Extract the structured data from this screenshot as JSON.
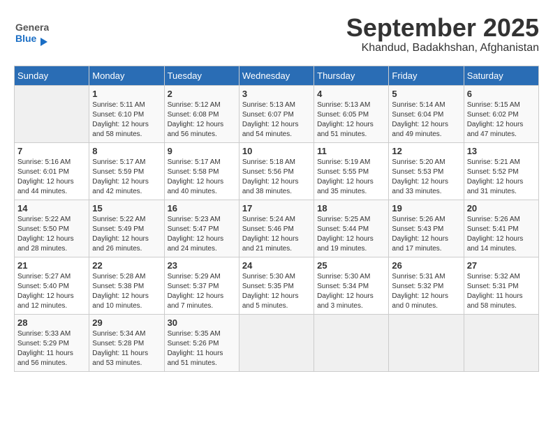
{
  "header": {
    "logo_general": "General",
    "logo_blue": "Blue",
    "month": "September 2025",
    "location": "Khandud, Badakhshan, Afghanistan"
  },
  "weekdays": [
    "Sunday",
    "Monday",
    "Tuesday",
    "Wednesday",
    "Thursday",
    "Friday",
    "Saturday"
  ],
  "weeks": [
    [
      {
        "day": "",
        "info": ""
      },
      {
        "day": "1",
        "info": "Sunrise: 5:11 AM\nSunset: 6:10 PM\nDaylight: 12 hours\nand 58 minutes."
      },
      {
        "day": "2",
        "info": "Sunrise: 5:12 AM\nSunset: 6:08 PM\nDaylight: 12 hours\nand 56 minutes."
      },
      {
        "day": "3",
        "info": "Sunrise: 5:13 AM\nSunset: 6:07 PM\nDaylight: 12 hours\nand 54 minutes."
      },
      {
        "day": "4",
        "info": "Sunrise: 5:13 AM\nSunset: 6:05 PM\nDaylight: 12 hours\nand 51 minutes."
      },
      {
        "day": "5",
        "info": "Sunrise: 5:14 AM\nSunset: 6:04 PM\nDaylight: 12 hours\nand 49 minutes."
      },
      {
        "day": "6",
        "info": "Sunrise: 5:15 AM\nSunset: 6:02 PM\nDaylight: 12 hours\nand 47 minutes."
      }
    ],
    [
      {
        "day": "7",
        "info": "Sunrise: 5:16 AM\nSunset: 6:01 PM\nDaylight: 12 hours\nand 44 minutes."
      },
      {
        "day": "8",
        "info": "Sunrise: 5:17 AM\nSunset: 5:59 PM\nDaylight: 12 hours\nand 42 minutes."
      },
      {
        "day": "9",
        "info": "Sunrise: 5:17 AM\nSunset: 5:58 PM\nDaylight: 12 hours\nand 40 minutes."
      },
      {
        "day": "10",
        "info": "Sunrise: 5:18 AM\nSunset: 5:56 PM\nDaylight: 12 hours\nand 38 minutes."
      },
      {
        "day": "11",
        "info": "Sunrise: 5:19 AM\nSunset: 5:55 PM\nDaylight: 12 hours\nand 35 minutes."
      },
      {
        "day": "12",
        "info": "Sunrise: 5:20 AM\nSunset: 5:53 PM\nDaylight: 12 hours\nand 33 minutes."
      },
      {
        "day": "13",
        "info": "Sunrise: 5:21 AM\nSunset: 5:52 PM\nDaylight: 12 hours\nand 31 minutes."
      }
    ],
    [
      {
        "day": "14",
        "info": "Sunrise: 5:22 AM\nSunset: 5:50 PM\nDaylight: 12 hours\nand 28 minutes."
      },
      {
        "day": "15",
        "info": "Sunrise: 5:22 AM\nSunset: 5:49 PM\nDaylight: 12 hours\nand 26 minutes."
      },
      {
        "day": "16",
        "info": "Sunrise: 5:23 AM\nSunset: 5:47 PM\nDaylight: 12 hours\nand 24 minutes."
      },
      {
        "day": "17",
        "info": "Sunrise: 5:24 AM\nSunset: 5:46 PM\nDaylight: 12 hours\nand 21 minutes."
      },
      {
        "day": "18",
        "info": "Sunrise: 5:25 AM\nSunset: 5:44 PM\nDaylight: 12 hours\nand 19 minutes."
      },
      {
        "day": "19",
        "info": "Sunrise: 5:26 AM\nSunset: 5:43 PM\nDaylight: 12 hours\nand 17 minutes."
      },
      {
        "day": "20",
        "info": "Sunrise: 5:26 AM\nSunset: 5:41 PM\nDaylight: 12 hours\nand 14 minutes."
      }
    ],
    [
      {
        "day": "21",
        "info": "Sunrise: 5:27 AM\nSunset: 5:40 PM\nDaylight: 12 hours\nand 12 minutes."
      },
      {
        "day": "22",
        "info": "Sunrise: 5:28 AM\nSunset: 5:38 PM\nDaylight: 12 hours\nand 10 minutes."
      },
      {
        "day": "23",
        "info": "Sunrise: 5:29 AM\nSunset: 5:37 PM\nDaylight: 12 hours\nand 7 minutes."
      },
      {
        "day": "24",
        "info": "Sunrise: 5:30 AM\nSunset: 5:35 PM\nDaylight: 12 hours\nand 5 minutes."
      },
      {
        "day": "25",
        "info": "Sunrise: 5:30 AM\nSunset: 5:34 PM\nDaylight: 12 hours\nand 3 minutes."
      },
      {
        "day": "26",
        "info": "Sunrise: 5:31 AM\nSunset: 5:32 PM\nDaylight: 12 hours\nand 0 minutes."
      },
      {
        "day": "27",
        "info": "Sunrise: 5:32 AM\nSunset: 5:31 PM\nDaylight: 11 hours\nand 58 minutes."
      }
    ],
    [
      {
        "day": "28",
        "info": "Sunrise: 5:33 AM\nSunset: 5:29 PM\nDaylight: 11 hours\nand 56 minutes."
      },
      {
        "day": "29",
        "info": "Sunrise: 5:34 AM\nSunset: 5:28 PM\nDaylight: 11 hours\nand 53 minutes."
      },
      {
        "day": "30",
        "info": "Sunrise: 5:35 AM\nSunset: 5:26 PM\nDaylight: 11 hours\nand 51 minutes."
      },
      {
        "day": "",
        "info": ""
      },
      {
        "day": "",
        "info": ""
      },
      {
        "day": "",
        "info": ""
      },
      {
        "day": "",
        "info": ""
      }
    ]
  ]
}
